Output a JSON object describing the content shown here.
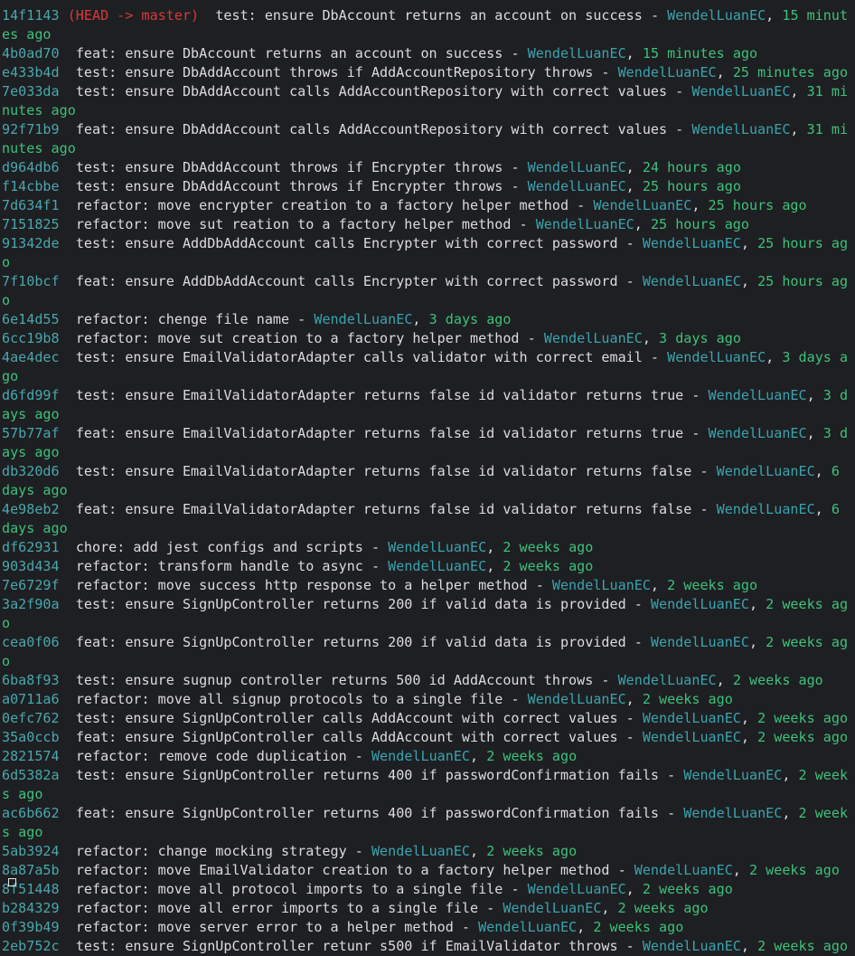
{
  "terminal": {
    "commits": [
      {
        "hash": "14f1143",
        "refs": "(HEAD -> master)",
        "message": "test: ensure DbAccount returns an account on success",
        "author": "WendelLuanEC",
        "time": "15 minutes ago"
      },
      {
        "hash": "4b0ad70",
        "refs": "",
        "message": "feat: ensure DbAccount returns an account on success",
        "author": "WendelLuanEC",
        "time": "15 minutes ago"
      },
      {
        "hash": "e433b4d",
        "refs": "",
        "message": "test: ensure DbAddAccount throws if AddAccountRepository throws",
        "author": "WendelLuanEC",
        "time": "25 minutes ago"
      },
      {
        "hash": "7e033da",
        "refs": "",
        "message": "test: ensure DbAddAccount calls AddAccountRepository with correct values",
        "author": "WendelLuanEC",
        "time": "31 minutes ago"
      },
      {
        "hash": "92f71b9",
        "refs": "",
        "message": "feat: ensure DbAddAccount calls AddAccountRepository with correct values",
        "author": "WendelLuanEC",
        "time": "31 minutes ago"
      },
      {
        "hash": "d964db6",
        "refs": "",
        "message": "test: ensure DbAddAccount throws if Encrypter throws",
        "author": "WendelLuanEC",
        "time": "24 hours ago"
      },
      {
        "hash": "f14cbbe",
        "refs": "",
        "message": "test: ensure DbAddAccount throws if Encrypter throws",
        "author": "WendelLuanEC",
        "time": "25 hours ago"
      },
      {
        "hash": "7d634f1",
        "refs": "",
        "message": "refactor: move encrypter creation to a factory helper method",
        "author": "WendelLuanEC",
        "time": "25 hours ago"
      },
      {
        "hash": "7151825",
        "refs": "",
        "message": "refactor: move sut reation to a factory helper method",
        "author": "WendelLuanEC",
        "time": "25 hours ago"
      },
      {
        "hash": "91342de",
        "refs": "",
        "message": "test: ensure AddDbAddAccount calls Encrypter with correct password",
        "author": "WendelLuanEC",
        "time": "25 hours ago"
      },
      {
        "hash": "7f10bcf",
        "refs": "",
        "message": "feat: ensure AddDbAddAccount calls Encrypter with correct password",
        "author": "WendelLuanEC",
        "time": "25 hours ago"
      },
      {
        "hash": "6e14d55",
        "refs": "",
        "message": "refactor: chenge file name",
        "author": "WendelLuanEC",
        "time": "3 days ago"
      },
      {
        "hash": "6cc19b8",
        "refs": "",
        "message": "refactor: move sut creation to a factory helper method",
        "author": "WendelLuanEC",
        "time": "3 days ago"
      },
      {
        "hash": "4ae4dec",
        "refs": "",
        "message": "test: ensure EmailValidatorAdapter calls validator with correct email",
        "author": "WendelLuanEC",
        "time": "3 days ago"
      },
      {
        "hash": "d6fd99f",
        "refs": "",
        "message": "test: ensure EmailValidatorAdapter returns false id validator returns true",
        "author": "WendelLuanEC",
        "time": "3 days ago"
      },
      {
        "hash": "57b77af",
        "refs": "",
        "message": "feat: ensure EmailValidatorAdapter returns false id validator returns true",
        "author": "WendelLuanEC",
        "time": "3 days ago"
      },
      {
        "hash": "db320d6",
        "refs": "",
        "message": "test: ensure EmailValidatorAdapter returns false id validator returns false",
        "author": "WendelLuanEC",
        "time": "6 days ago"
      },
      {
        "hash": "4e98eb2",
        "refs": "",
        "message": "feat: ensure EmailValidatorAdapter returns false id validator returns false",
        "author": "WendelLuanEC",
        "time": "6 days ago"
      },
      {
        "hash": "df62931",
        "refs": "",
        "message": "chore: add jest configs and scripts",
        "author": "WendelLuanEC",
        "time": "2 weeks ago"
      },
      {
        "hash": "903d434",
        "refs": "",
        "message": "refactor: transform handle to async",
        "author": "WendelLuanEC",
        "time": "2 weeks ago"
      },
      {
        "hash": "7e6729f",
        "refs": "",
        "message": "refactor: move success http response to a helper method",
        "author": "WendelLuanEC",
        "time": "2 weeks ago"
      },
      {
        "hash": "3a2f90a",
        "refs": "",
        "message": "test: ensure SignUpController returns 200 if valid data is provided",
        "author": "WendelLuanEC",
        "time": "2 weeks ago"
      },
      {
        "hash": "cea0f06",
        "refs": "",
        "message": "feat: ensure SignUpController returns 200 if valid data is provided",
        "author": "WendelLuanEC",
        "time": "2 weeks ago"
      },
      {
        "hash": "6ba8f93",
        "refs": "",
        "message": "test: ensure sugnup controller returns 500 id AddAccount throws",
        "author": "WendelLuanEC",
        "time": "2 weeks ago"
      },
      {
        "hash": "a0711a6",
        "refs": "",
        "message": "refactor: move all signup protocols to a single file",
        "author": "WendelLuanEC",
        "time": "2 weeks ago"
      },
      {
        "hash": "0efc762",
        "refs": "",
        "message": "test: ensure SignUpController calls AddAccount with correct values",
        "author": "WendelLuanEC",
        "time": "2 weeks ago"
      },
      {
        "hash": "35a0ccb",
        "refs": "",
        "message": "feat: ensure SignUpController calls AddAccount with correct values",
        "author": "WendelLuanEC",
        "time": "2 weeks ago"
      },
      {
        "hash": "2821574",
        "refs": "",
        "message": "refactor: remove code duplication",
        "author": "WendelLuanEC",
        "time": "2 weeks ago"
      },
      {
        "hash": "6d5382a",
        "refs": "",
        "message": "test: ensure SignUpController returns 400 if passwordConfirmation fails",
        "author": "WendelLuanEC",
        "time": "2 weeks ago"
      },
      {
        "hash": "ac6b662",
        "refs": "",
        "message": "feat: ensure SignUpController returns 400 if passwordConfirmation fails",
        "author": "WendelLuanEC",
        "time": "2 weeks ago"
      },
      {
        "hash": "5ab3924",
        "refs": "",
        "message": "refactor: change mocking strategy",
        "author": "WendelLuanEC",
        "time": "2 weeks ago"
      },
      {
        "hash": "8a87a5b",
        "refs": "",
        "message": "refactor: move EmailValidator creation to a factory helper method",
        "author": "WendelLuanEC",
        "time": "2 weeks ago"
      },
      {
        "hash": "8f51448",
        "refs": "",
        "message": "refactor: move all protocol imports to a single file",
        "author": "WendelLuanEC",
        "time": "2 weeks ago"
      },
      {
        "hash": "b284329",
        "refs": "",
        "message": "refactor: move all error imports to a single file",
        "author": "WendelLuanEC",
        "time": "2 weeks ago"
      },
      {
        "hash": "0f39b49",
        "refs": "",
        "message": "refactor: move server error to a helper method",
        "author": "WendelLuanEC",
        "time": "2 weeks ago"
      },
      {
        "hash": "2eb752c",
        "refs": "",
        "message": "test: ensure SignUpController retunr s500 if EmailValidator throws",
        "author": "WendelLuanEC",
        "time": "2 weeks ago"
      }
    ]
  },
  "colors": {
    "background": "#1e1f22",
    "hash": "#4aa6ad",
    "refs": "#d83a3a",
    "author": "#3aa3ae",
    "time": "#3ec07b",
    "text": "#dcdcdc"
  }
}
